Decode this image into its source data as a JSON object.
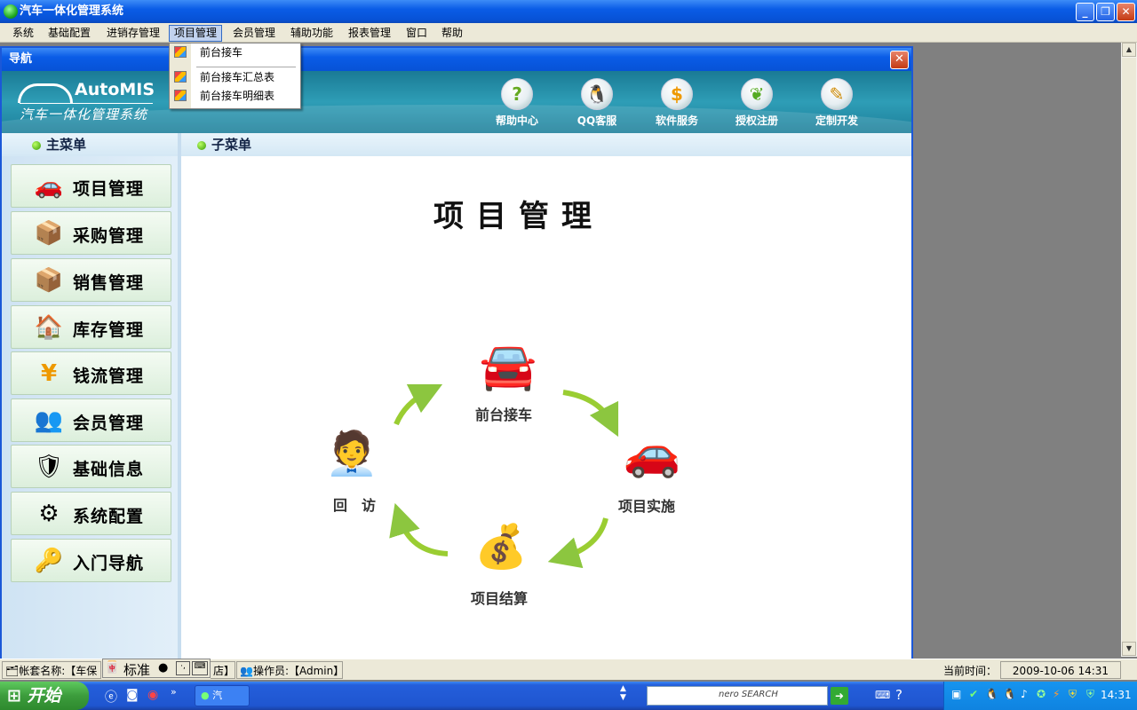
{
  "window": {
    "title": "汽车一体化管理系统"
  },
  "menubar": {
    "items": [
      "系统",
      "基础配置",
      "进销存管理",
      "项目管理",
      "会员管理",
      "辅助功能",
      "报表管理",
      "窗口",
      "帮助"
    ]
  },
  "dropdown": {
    "items": [
      "前台接车",
      "前台接车汇总表",
      "前台接车明细表"
    ]
  },
  "nav": {
    "title": "导航",
    "close_label": "✕",
    "logo_en": "AutoMIS",
    "logo_cn": "汽车一体化管理系统",
    "toolbar": [
      "帮助中心",
      "QQ客服",
      "软件服务",
      "授权注册",
      "定制开发"
    ],
    "main_menu_label": "主菜单",
    "sub_menu_label": "子菜单",
    "main_menu": [
      "项目管理",
      "采购管理",
      "销售管理",
      "库存管理",
      "钱流管理",
      "会员管理",
      "基础信息",
      "系统配置",
      "入门导航"
    ]
  },
  "content": {
    "title": "项目管理",
    "cycle": [
      "前台接车",
      "项目实施",
      "项目结算",
      "回　访"
    ]
  },
  "statusbar": {
    "account": "帐套名称:【车保",
    "account_tail": "店】",
    "operator": "操作员:【Admin】",
    "time_label": "当前时间：",
    "time_value": "2009-10-06 14:31"
  },
  "ime": {
    "mode": "标准"
  },
  "taskbar": {
    "start_label": "开始",
    "task_label": "汽",
    "search_brand": "nero SEARCH",
    "clock": "14:31"
  },
  "colors": {
    "titlebar": "#0a5ce6",
    "banner": "#2e9db6",
    "menu_active": "#c1d2ee",
    "button_bg": "#dcefdc"
  }
}
